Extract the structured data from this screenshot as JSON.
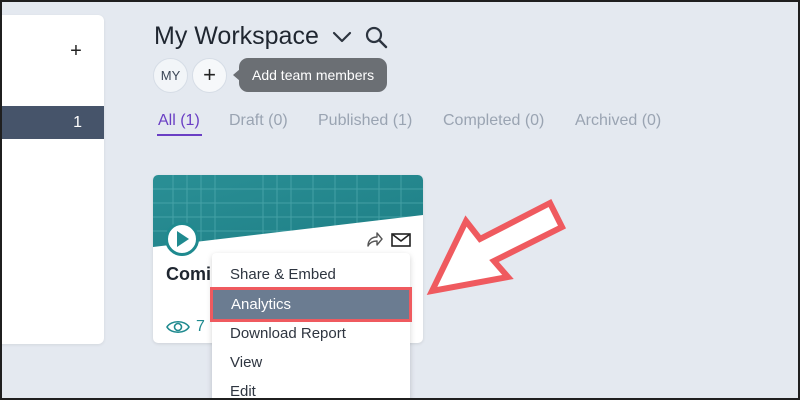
{
  "sidebar": {
    "add_icon": "plus-icon",
    "add_label": "+",
    "selected_count": "1"
  },
  "header": {
    "title": "My Workspace",
    "dropdown_icon": "chevron-down-icon",
    "search_icon": "search-icon"
  },
  "members": {
    "avatar_initials": "MY",
    "add_label": "+",
    "tooltip": "Add team members"
  },
  "tabs": [
    {
      "label": "All (1)",
      "active": true
    },
    {
      "label": "Draft (0)",
      "active": false
    },
    {
      "label": "Published (1)",
      "active": false
    },
    {
      "label": "Completed (0)",
      "active": false
    },
    {
      "label": "Archived (0)",
      "active": false
    }
  ],
  "card": {
    "title": "Comi",
    "views": "7",
    "play_icon": "play-icon",
    "share_icon": "share-icon",
    "mail_icon": "mail-icon",
    "views_icon": "eye-icon"
  },
  "menu": {
    "items": [
      {
        "label": "Share & Embed"
      },
      {
        "label": "Analytics",
        "highlighted": true
      },
      {
        "label": "Download Report"
      },
      {
        "label": "View"
      },
      {
        "label": "Edit"
      }
    ]
  },
  "colors": {
    "accent": "#6a3fc4",
    "teal": "#1f8a8f",
    "highlight_border": "#ef5a5f",
    "sidebar_selected": "#46546a"
  }
}
